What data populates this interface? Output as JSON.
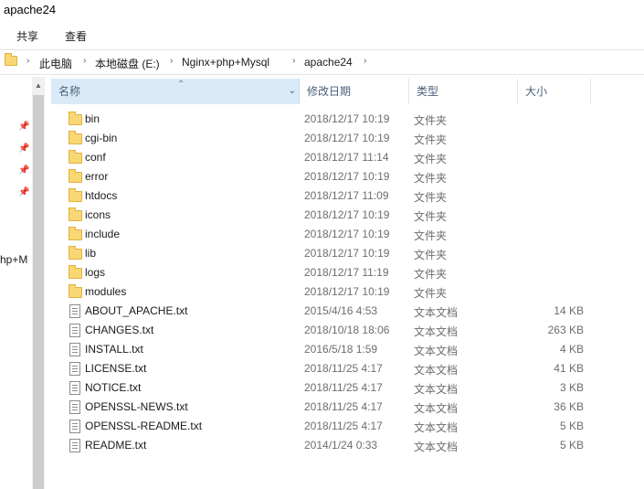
{
  "window": {
    "title": "apache24"
  },
  "ribbon": {
    "tabs": [
      "共享",
      "查看"
    ]
  },
  "address_bar": {
    "breadcrumbs": [
      "此电脑",
      "本地磁盘 (E:)",
      "Nginx+php+Mysql",
      "apache24"
    ],
    "separator": "›"
  },
  "navigation": {
    "clipped_text": "hp+M"
  },
  "columns": {
    "name": "名称",
    "date": "修改日期",
    "type": "类型",
    "size": "大小"
  },
  "icons": {
    "sort_indicator": "sort-ascending-icon",
    "pin": "pin-icon",
    "folder": "folder-icon",
    "text_file": "text-file-icon"
  },
  "files": [
    {
      "name": "bin",
      "date": "2018/12/17 10:19",
      "type": "文件夹",
      "size": "",
      "kind": "folder"
    },
    {
      "name": "cgi-bin",
      "date": "2018/12/17 10:19",
      "type": "文件夹",
      "size": "",
      "kind": "folder"
    },
    {
      "name": "conf",
      "date": "2018/12/17 11:14",
      "type": "文件夹",
      "size": "",
      "kind": "folder"
    },
    {
      "name": "error",
      "date": "2018/12/17 10:19",
      "type": "文件夹",
      "size": "",
      "kind": "folder"
    },
    {
      "name": "htdocs",
      "date": "2018/12/17 11:09",
      "type": "文件夹",
      "size": "",
      "kind": "folder"
    },
    {
      "name": "icons",
      "date": "2018/12/17 10:19",
      "type": "文件夹",
      "size": "",
      "kind": "folder"
    },
    {
      "name": "include",
      "date": "2018/12/17 10:19",
      "type": "文件夹",
      "size": "",
      "kind": "folder"
    },
    {
      "name": "lib",
      "date": "2018/12/17 10:19",
      "type": "文件夹",
      "size": "",
      "kind": "folder"
    },
    {
      "name": "logs",
      "date": "2018/12/17 11:19",
      "type": "文件夹",
      "size": "",
      "kind": "folder"
    },
    {
      "name": "modules",
      "date": "2018/12/17 10:19",
      "type": "文件夹",
      "size": "",
      "kind": "folder"
    },
    {
      "name": "ABOUT_APACHE.txt",
      "date": "2015/4/16 4:53",
      "type": "文本文档",
      "size": "14 KB",
      "kind": "file"
    },
    {
      "name": "CHANGES.txt",
      "date": "2018/10/18 18:06",
      "type": "文本文档",
      "size": "263 KB",
      "kind": "file"
    },
    {
      "name": "INSTALL.txt",
      "date": "2016/5/18 1:59",
      "type": "文本文档",
      "size": "4 KB",
      "kind": "file"
    },
    {
      "name": "LICENSE.txt",
      "date": "2018/11/25 4:17",
      "type": "文本文档",
      "size": "41 KB",
      "kind": "file"
    },
    {
      "name": "NOTICE.txt",
      "date": "2018/11/25 4:17",
      "type": "文本文档",
      "size": "3 KB",
      "kind": "file"
    },
    {
      "name": "OPENSSL-NEWS.txt",
      "date": "2018/11/25 4:17",
      "type": "文本文档",
      "size": "36 KB",
      "kind": "file"
    },
    {
      "name": "OPENSSL-README.txt",
      "date": "2018/11/25 4:17",
      "type": "文本文档",
      "size": "5 KB",
      "kind": "file"
    },
    {
      "name": "README.txt",
      "date": "2014/1/24 0:33",
      "type": "文本文档",
      "size": "5 KB",
      "kind": "file"
    }
  ]
}
